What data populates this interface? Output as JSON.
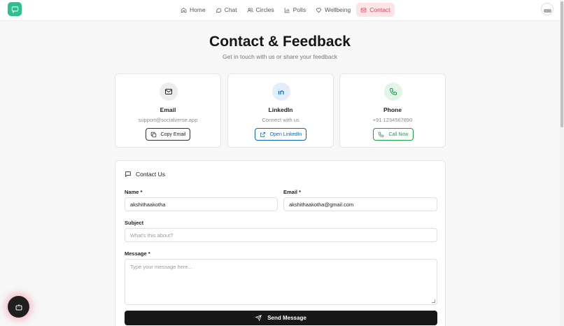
{
  "nav": {
    "items": [
      {
        "label": "Home",
        "icon": "home-icon"
      },
      {
        "label": "Chat",
        "icon": "chat-icon"
      },
      {
        "label": "Circles",
        "icon": "users-icon"
      },
      {
        "label": "Polls",
        "icon": "bar-chart-icon"
      },
      {
        "label": "Wellbeing",
        "icon": "heart-icon"
      },
      {
        "label": "Contact",
        "icon": "mail-icon",
        "active": true
      }
    ]
  },
  "header": {
    "title": "Contact & Feedback",
    "subtitle": "Get in touch with us or share your feedback"
  },
  "cards": {
    "email": {
      "title": "Email",
      "sub": "support@socialverse.app",
      "button": "Copy Email",
      "color": "#333333"
    },
    "linkedin": {
      "title": "LinkedIn",
      "sub": "Connect with us",
      "button": "Open LinkedIn",
      "color": "#0a66c2"
    },
    "phone": {
      "title": "Phone",
      "sub": "+91 1234567890",
      "button": "Call Now",
      "color": "#16a34a"
    }
  },
  "form": {
    "heading": "Contact Us",
    "name_label": "Name *",
    "name_value": "akshithaakotha",
    "email_label": "Email *",
    "email_value": "akshithaakotha@gmail.com",
    "subject_label": "Subject",
    "subject_placeholder": "What's this about?",
    "message_label": "Message *",
    "message_placeholder": "Type your message here...",
    "send_label": "Send Message"
  },
  "colors": {
    "accent": "#e0445a",
    "brand": "#2fbf8f"
  }
}
